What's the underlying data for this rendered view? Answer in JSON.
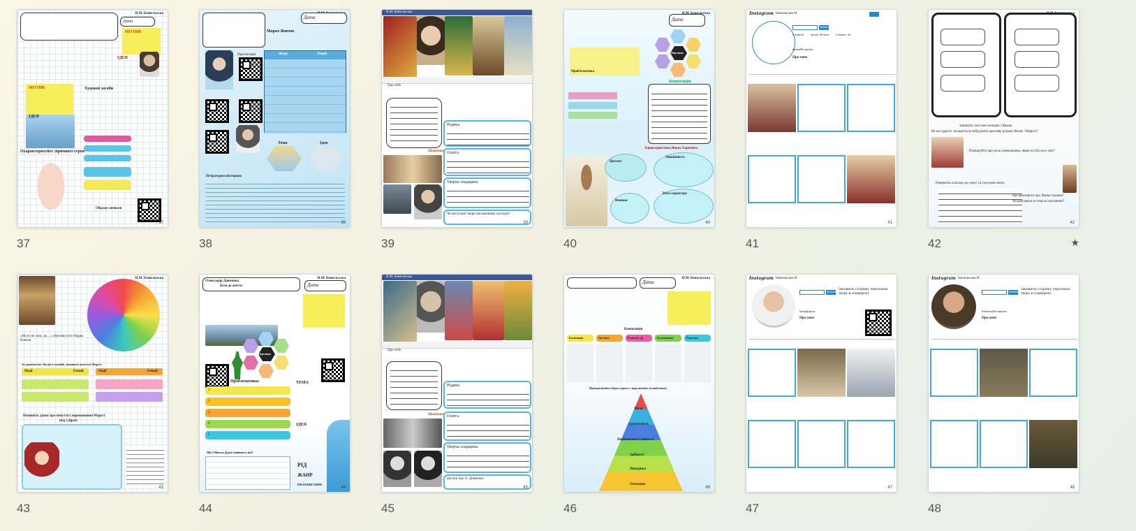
{
  "slides": [
    {
      "number": "37",
      "author": "Н.М. Бевзельська"
    },
    {
      "number": "38",
      "author": "Н.М. Бевзельська"
    },
    {
      "number": "39",
      "author": "Н.М. Бевзельська"
    },
    {
      "number": "40",
      "author": "Н.М. Бевзельська"
    },
    {
      "number": "41",
      "author": "Бевзельська Н."
    },
    {
      "number": "42",
      "author": "Н.М. Бевзельська",
      "starred": true
    },
    {
      "number": "43",
      "author": "Н.М. Бевзельська"
    },
    {
      "number": "44",
      "author": "Н.М. Бевзельська"
    },
    {
      "number": "45",
      "author": "Н.М. Бевзельська"
    },
    {
      "number": "46",
      "author": "Н.М. Бевзельська"
    },
    {
      "number": "47",
      "author": "Бевзельська Н."
    },
    {
      "number": "48",
      "author": "Бевзельська Н."
    }
  ],
  "star_icon": "★",
  "s37": {
    "date_label": "Дата",
    "motive": "МОТИВ",
    "idea": "ІДЕЯ",
    "images": "Художні засоби",
    "hero": "Охарактеризуйте ліричного героя",
    "symbols": "Образи-символи"
  },
  "s38": {
    "date_label": "Дата",
    "title": "Марко Вовчок",
    "presentation": "Презентація",
    "theme": "Тема",
    "idea": "Ідея",
    "genre": "Жанр",
    "works": "Твори",
    "lit": "Літературна вікторина"
  },
  "s39": {
    "author": "Н.М. Бевзельська",
    "about": "Про себе",
    "family": "Родина",
    "education": "Освіта",
    "creative": "Творча спадщина",
    "photos": "Цікавинки фото",
    "question": "Чи актуальні твори письменниці сьогодні?"
  },
  "s40": {
    "date_label": "Дата",
    "author": "Н.М. Бевзельська",
    "character": "Персонаж",
    "compose": "Композиція",
    "title": "Характеристика Якова Харченка",
    "quotes": "Цитати",
    "deeds": "Вчинки",
    "appearance": "Зовнішність",
    "traits": "Риси характеру",
    "problematics": "Проблематика"
  },
  "s41": {
    "brand": "Instagram",
    "user": "Бевзельська Н.",
    "posts": "0 дописів",
    "followers": "читачі: 40,5млн",
    "following": "Стежить: 44",
    "bio": "Про мене",
    "tag": "#назваФоторубка",
    "follow": "Змінити"
  },
  "s42": {
    "author": "Н.М. Бевзельська",
    "q1": "Запишіть свої між позицію і Явкою",
    "q2": "Як ви гадаєте, чи вдасться побудувати щасливу родину Якову і Марусі?",
    "q3": "Поміркуйте про роль повчальника, якщо на білі косі світ?",
    "list_intro": "Поверніть спогади до сенсу та стосунки свого",
    "q4": "Що важливого про Якова сказано?",
    "q5": "Чи реагувала за тема в сьогоденні?"
  },
  "s43": {
    "author": "Н.М. Бевзельська",
    "q1": "«Ніхто не знає, як…» обумови того Марко Вовчок",
    "table_title": "За допомогою «Колеса емоцій» визначте почуття Марусі",
    "col1": "Події",
    "col2": "Емоції",
    "col3": "Події",
    "col4": "Емоції",
    "write": "Напишіть допис про почуття і переживання Марусі",
    "limit": "(від 5 фраз)"
  },
  "s44": {
    "date_label": "Дата",
    "author": "Н.М. Бевзельська",
    "title": "Олександр Довженко",
    "subtitle": "Біля до життя",
    "character": "Персонаж",
    "problems": "Проблематика:",
    "theme": "ТЕМА",
    "idea": "ІДЕЯ",
    "rid": "РІД",
    "zhanr": "ЖАНР",
    "year": "РІК НАПИСАННЯ",
    "quiz": "Що б Микола Дурен знайшов в лікі?",
    "nums": [
      "1",
      "2",
      "3",
      "4",
      "5"
    ]
  },
  "s45": {
    "author": "Н.М. Бевзельська",
    "about": "Про себе",
    "family": "Родина",
    "education": "Освіта",
    "creative": "Творча спадщина",
    "photos": "Цікавинки фото",
    "question": "Цитати про О. Довженка"
  },
  "s46": {
    "date_label": "Дата",
    "author": "Н.М. Бевзельська",
    "compose": "Композиція",
    "cols": [
      "Експозиція",
      "Зав'язка",
      "Розвиток дії",
      "Кульмінація",
      "Розв'язка"
    ],
    "pyramid_title": "Проаналізуйте образ одного з персонажів за шаблоном",
    "levels": [
      "Місія",
      "Ідентичність",
      "Переконання і цінності",
      "Здібності",
      "Поведінка",
      "Оточення"
    ]
  },
  "s47": {
    "brand": "Instagram",
    "user": "Бевзельська Н.",
    "follow_prompt": "Заповніть сторінку персонажа твору в соцмережі.",
    "bio": "Про мене",
    "tag": "#лікарБарсук",
    "follow": "Змінити"
  },
  "s48": {
    "brand": "Instagram",
    "user": "Бевзельська Н.",
    "follow_prompt": "Заповніть сторінку персонажа твору в соцмережі.",
    "bio": "Про мене",
    "tag": "#світлиціФотокартка",
    "follow": "Змінити"
  }
}
